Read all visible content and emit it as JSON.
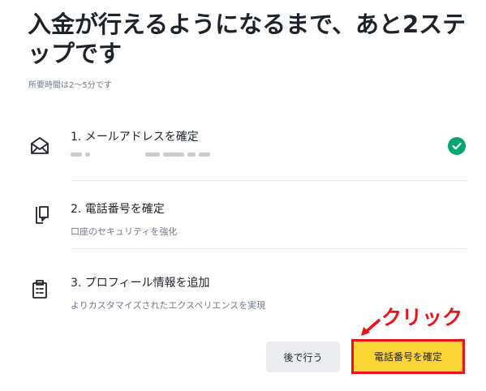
{
  "header": {
    "title": "入金が行えるようになるまで、あと2ステップです",
    "subtitle": "所要時間は2〜5分です"
  },
  "steps": [
    {
      "label": "1. メールアドレスを確定",
      "icon": "envelope-icon",
      "status": "completed"
    },
    {
      "label": "2. 電話番号を確定",
      "description": "口座のセキュリティを強化",
      "icon": "phone-verify-icon"
    },
    {
      "label": "3. プロフィール情報を追加",
      "description": "よりカスタマイズされたエクスペリエンスを実現",
      "icon": "clipboard-icon"
    }
  ],
  "actions": {
    "later_label": "後で行う",
    "confirm_label": "電話番号を確定"
  },
  "annotation": {
    "label": "クリック",
    "color": "#e8141b"
  },
  "colors": {
    "accent": "#fcd535",
    "success": "#03a66d",
    "highlight": "#e8141b"
  }
}
